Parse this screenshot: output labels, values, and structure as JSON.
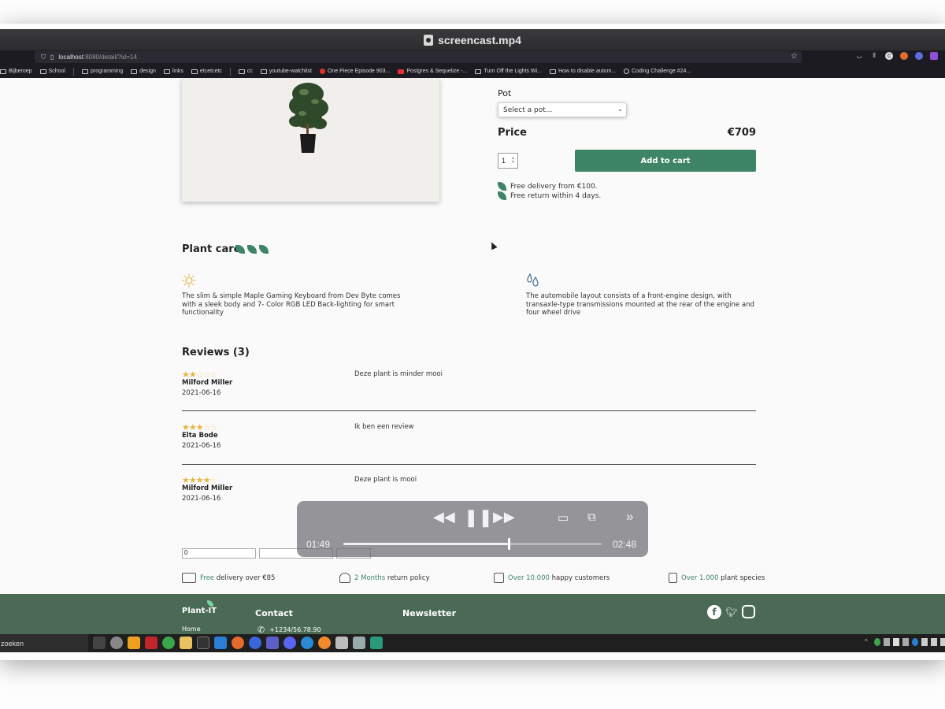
{
  "window": {
    "title": "screencast.mp4"
  },
  "browser": {
    "url_host": "localhost",
    "url_rest": ":8080/detail/?id=14",
    "bookmarks": [
      "Bijberoep",
      "School",
      "programming",
      "design",
      "links",
      "etcetcetc",
      "cc",
      "youtube-watchlist",
      "One Piece Episode 903...",
      "Postgres & Sequelize -...",
      "Turn Off the Lights Wi...",
      "How to disable autom...",
      "Coding Challenge #24..."
    ]
  },
  "product": {
    "pot_label": "Pot",
    "pot_placeholder": "Select a pot...",
    "price_label": "Price",
    "price_value": "€709",
    "quantity": "1",
    "add_to_cart": "Add to cart",
    "perks": [
      "Free delivery from €100.",
      "Free return within 4 days."
    ]
  },
  "plant_care": {
    "title": "Plant care",
    "level": 3,
    "light_text": "The slim & simple Maple Gaming Keyboard from Dev Byte comes with a sleek body and 7- Color RGB LED Back-lighting for smart functionality",
    "water_text": "The automobile layout consists of a front-engine design, with transaxle-type transmissions mounted at the rear of the engine and four wheel drive"
  },
  "reviews": {
    "title": "Reviews (3)",
    "items": [
      {
        "rating": 2,
        "author": "Milford Miller",
        "date": "2021-06-16",
        "comment": "Deze plant is minder mooi"
      },
      {
        "rating": 3,
        "author": "Elta Bode",
        "date": "2021-06-16",
        "comment": "Ik ben een review"
      },
      {
        "rating": 4,
        "author": "Milford Miller",
        "date": "2021-06-16",
        "comment": "Deze plant is mooi"
      }
    ],
    "form_rating_value": "0"
  },
  "usps": [
    {
      "highlight": "Free",
      "rest": " delivery over €85"
    },
    {
      "highlight": "2 Months",
      "rest": " return policy"
    },
    {
      "highlight": "Over 10.000",
      "rest": " happy customers"
    },
    {
      "highlight": "Over 1.000",
      "rest": " plant species"
    }
  ],
  "footer": {
    "brand": "Plant-IT",
    "home": "Home",
    "contact_title": "Contact",
    "phone": "+1234/56.78.90",
    "newsletter_title": "Newsletter"
  },
  "player": {
    "elapsed": "01:49",
    "remaining": "02:48",
    "progress": 0.64
  },
  "taskbar": {
    "search_text": "zoeken"
  },
  "colors": {
    "accent": "#3e8568",
    "footer": "#4b6a56",
    "star": "#e8b43c"
  }
}
